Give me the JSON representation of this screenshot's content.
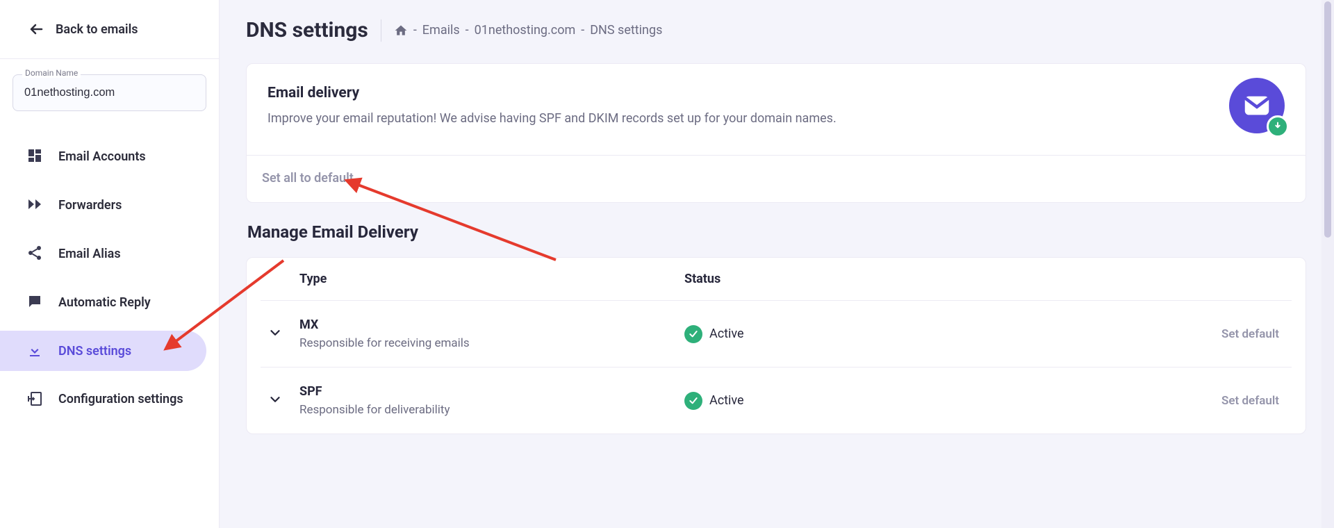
{
  "sidebar": {
    "back_label": "Back to emails",
    "domain_field_label": "Domain Name",
    "domain_value": "01nethosting.com",
    "nav": [
      {
        "id": "email-accounts",
        "label": "Email Accounts",
        "active": false
      },
      {
        "id": "forwarders",
        "label": "Forwarders",
        "active": false
      },
      {
        "id": "email-alias",
        "label": "Email Alias",
        "active": false
      },
      {
        "id": "automatic-reply",
        "label": "Automatic Reply",
        "active": false
      },
      {
        "id": "dns-settings",
        "label": "DNS settings",
        "active": true
      },
      {
        "id": "configuration-settings",
        "label": "Configuration settings",
        "active": false
      }
    ]
  },
  "header": {
    "title": "DNS settings",
    "breadcrumb": {
      "emails": "Emails",
      "domain": "01nethosting.com",
      "current": "DNS settings"
    }
  },
  "delivery_card": {
    "title": "Email delivery",
    "description": "Improve your email reputation! We advise having SPF and DKIM records set up for your domain names.",
    "set_all_label": "Set all to default"
  },
  "manage": {
    "section_title": "Manage Email Delivery",
    "headers": {
      "type": "Type",
      "status": "Status"
    },
    "records": [
      {
        "type": "MX",
        "desc": "Responsible for receiving emails",
        "status": "Active",
        "action": "Set default"
      },
      {
        "type": "SPF",
        "desc": "Responsible for deliverability",
        "status": "Active",
        "action": "Set default"
      }
    ]
  }
}
